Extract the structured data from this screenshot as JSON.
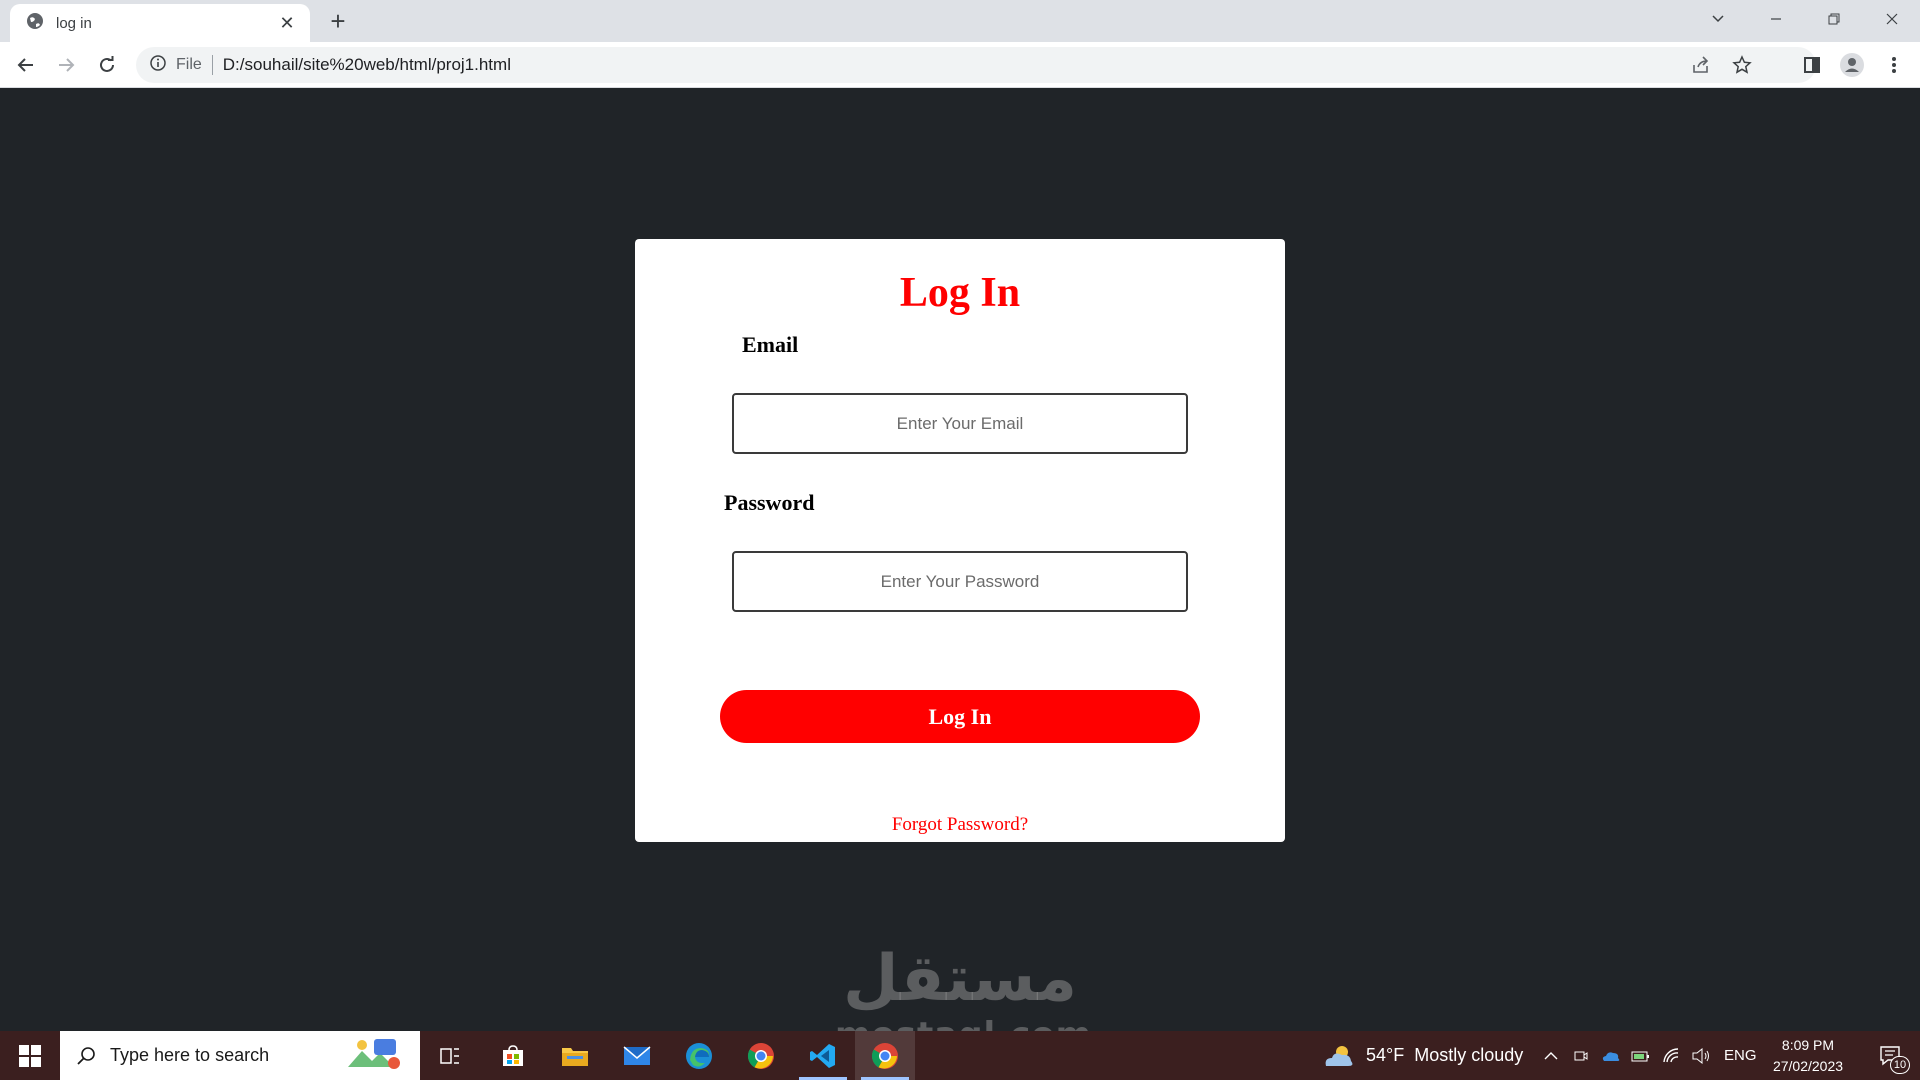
{
  "browser": {
    "tab_title": "log in",
    "url_scheme_label": "File",
    "url": "D:/souhail/site%20web/html/proj1.html"
  },
  "login_form": {
    "title": "Log In",
    "email_label": "Email",
    "email_placeholder": "Enter Your Email",
    "password_label": "Password",
    "password_placeholder": "Enter Your Password",
    "submit_label": "Log In",
    "forgot_link": "Forgot Password?",
    "accent_color": "#ff0000"
  },
  "watermark": {
    "arabic": "مستقل",
    "latin": "mostaql.com"
  },
  "taskbar": {
    "search_placeholder": "Type here to search",
    "weather_temp": "54°F",
    "weather_text": "Mostly cloudy",
    "language": "ENG",
    "time": "8:09 PM",
    "date": "27/02/2023",
    "notification_count": "10"
  }
}
